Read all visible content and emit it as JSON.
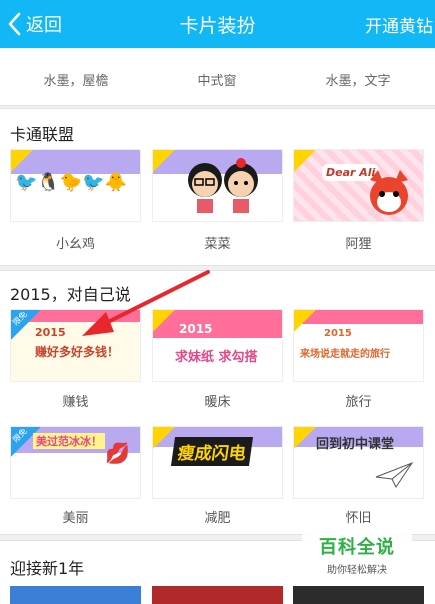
{
  "header": {
    "back_label": "返回",
    "title": "卡片装扮",
    "right_action": "开通黄钻"
  },
  "top_strip": {
    "labels": [
      "水墨，屋檐",
      "中式窗",
      "水墨，文字"
    ]
  },
  "sections": [
    {
      "title": "卡通联盟",
      "cards": [
        {
          "label": "小幺鸡",
          "band_color": "#b9a9f0",
          "art": "🐦🐧🐤🐦🐥"
        },
        {
          "label": "菜菜",
          "band_color": "#b9a9f0",
          "art": "菜菜"
        },
        {
          "label": "阿狸",
          "band_color": "#ff6f9a",
          "art": "Dear Ali"
        }
      ]
    },
    {
      "title": "2015，对自己说",
      "cards": [
        {
          "label": "赚钱",
          "band_color": "#ff6f9a",
          "art": "赚好多好多钱！",
          "art_top": "2015",
          "badge": "限免"
        },
        {
          "label": "暖床",
          "band_color": "#ff6f9a",
          "art": "求妹纸 求勾搭",
          "art_top": "2015"
        },
        {
          "label": "旅行",
          "band_color": "#ff6f9a",
          "art": "来场说走就走的旅行",
          "art_top": "2015"
        }
      ]
    },
    {
      "title": "",
      "cards": [
        {
          "label": "美丽",
          "band_color": "#b9a9f0",
          "art": "美过范冰冰！",
          "badge": "限免"
        },
        {
          "label": "减肥",
          "band_color": "#b9a9f0",
          "art": "瘦成闪电"
        },
        {
          "label": "怀旧",
          "band_color": "#b9a9f0",
          "art": "回到初中课堂"
        }
      ]
    },
    {
      "title": "迎接新1年",
      "cards": []
    }
  ],
  "watermark": {
    "main": "百科全说",
    "sub": "助你轻松解决"
  },
  "colors": {
    "header_bg": "#12b7f5",
    "annotation_arrow": "#e8262c"
  }
}
